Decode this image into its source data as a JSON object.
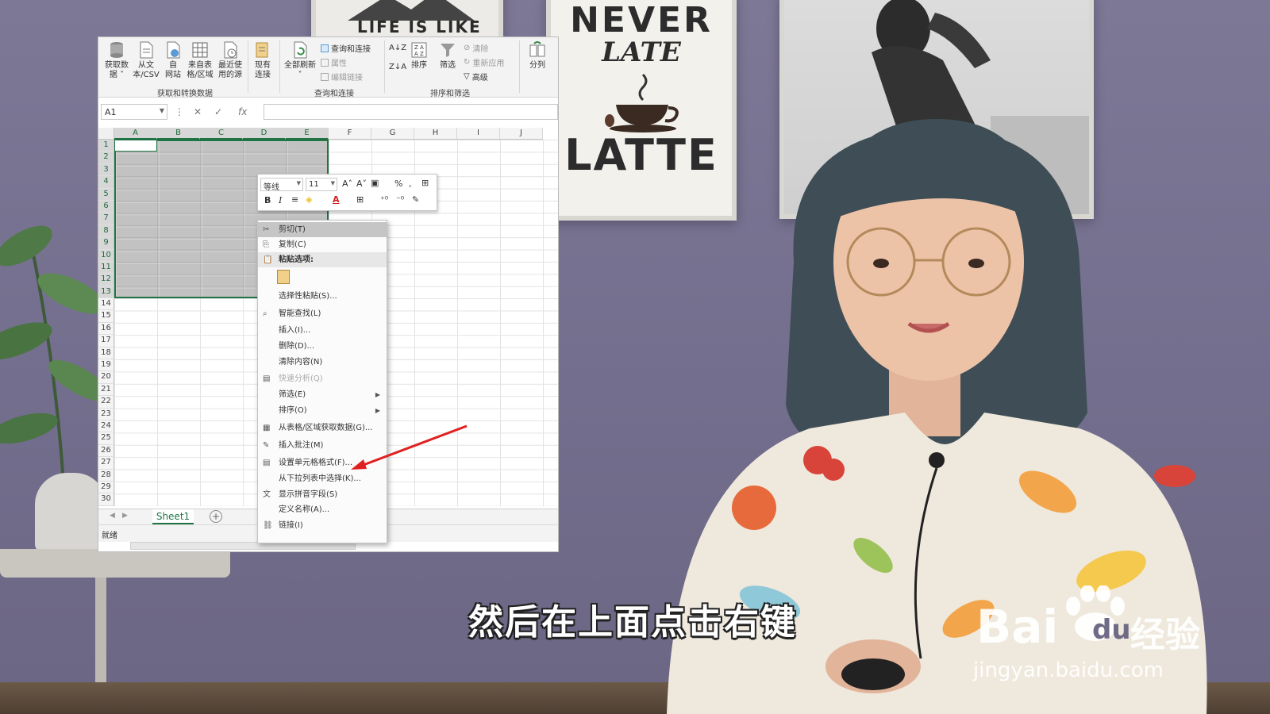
{
  "ribbon": {
    "buttons": [
      {
        "label1": "获取数",
        "label2": "据 ˅"
      },
      {
        "label1": "从文",
        "label2": "本/CSV"
      },
      {
        "label1": "自",
        "label2": "网站"
      },
      {
        "label1": "来自表",
        "label2": "格/区域"
      },
      {
        "label1": "最近使",
        "label2": "用的源"
      },
      {
        "label1": "现有",
        "label2": "连接"
      },
      {
        "label1": "全部刷新",
        "label2": "˅"
      }
    ],
    "query_small": [
      "查询和连接",
      "属性",
      "编辑链接"
    ],
    "sort_label": "排序",
    "filter_label": "筛选",
    "filter_small": [
      "清除",
      "重新应用",
      "高级"
    ],
    "split_label": "分列",
    "groups": [
      "获取和转换数据",
      "查询和连接",
      "排序和筛选"
    ]
  },
  "formula_bar": {
    "name_box": "A1",
    "cancel": "✕",
    "enter": "✓",
    "fx": "fx"
  },
  "grid": {
    "columns": [
      "A",
      "B",
      "C",
      "D",
      "E",
      "F",
      "G",
      "H",
      "I",
      "J"
    ],
    "rows": [
      "1",
      "2",
      "3",
      "4",
      "5",
      "6",
      "7",
      "8",
      "9",
      "10",
      "11",
      "12",
      "13",
      "14",
      "15",
      "16",
      "17",
      "18",
      "19",
      "20",
      "21",
      "22",
      "23",
      "24",
      "25",
      "26",
      "27",
      "28",
      "29",
      "30"
    ]
  },
  "sheet": {
    "tab": "Sheet1",
    "add": "+",
    "status": "就绪"
  },
  "mini_toolbar": {
    "font": "等线",
    "size": "11"
  },
  "context_menu": {
    "items": [
      "剪切(T)",
      "复制(C)",
      "粘贴选项:",
      "选择性粘贴(S)...",
      "智能查找(L)",
      "插入(I)...",
      "删除(D)...",
      "清除内容(N)",
      "快速分析(Q)",
      "筛选(E)",
      "排序(O)",
      "从表格/区域获取数据(G)...",
      "插入批注(M)",
      "设置单元格格式(F)...",
      "从下拉列表中选择(K)...",
      "显示拼音字段(S)",
      "定义名称(A)...",
      "链接(I)"
    ]
  },
  "overlay": {
    "subtitle": "然后在上面点击右键",
    "watermark_bai": "Bai",
    "watermark_du": "du",
    "watermark_jingyan": "经验",
    "watermark_url": "jingyan.baidu.com"
  },
  "posters": {
    "left": "LIFE IS LIKE",
    "mid_line1": "NEVER",
    "mid_line2": "LATE",
    "mid_line3": "LATTE"
  },
  "colors": {
    "excel_green": "#217346",
    "arrow_red": "#e02020",
    "wall": "#736e8d"
  }
}
